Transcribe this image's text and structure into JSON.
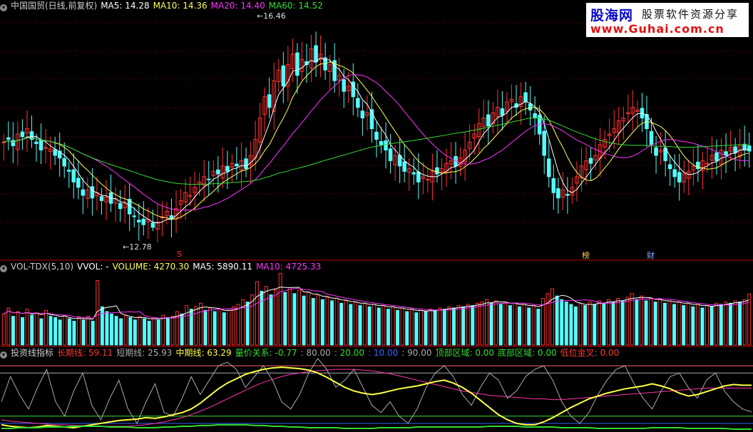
{
  "logo": {
    "name": "股海网",
    "tagline": "股票软件资源分享",
    "url": "www.Guhai.com.cn"
  },
  "price_panel": {
    "title": "中国国贸(日线,前复权)",
    "legend": [
      {
        "label": "MA5: 14.28",
        "color": "#ffffff"
      },
      {
        "label": "MA10: 14.36",
        "color": "#ffff55"
      },
      {
        "label": "MA20: 14.40",
        "color": "#ff33ff"
      },
      {
        "label": "MA60: 14.52",
        "color": "#33dd33"
      }
    ],
    "high_label": "16.46",
    "low_label": "12.78",
    "markers": [
      {
        "text": "S",
        "color": "#ff3333"
      },
      {
        "text": "榜",
        "color": "#ffcc55"
      },
      {
        "text": "财",
        "color": "#88aaff"
      }
    ]
  },
  "volume_panel": {
    "title": "VOL-TDX(5,10)",
    "legend": [
      {
        "label": "VVOL: -",
        "color": "#ffffff"
      },
      {
        "label": "VOLUME: 4270.30",
        "color": "#ffff55"
      },
      {
        "label": "MA5: 5890.11",
        "color": "#ffffff"
      },
      {
        "label": "MA10: 4725.33",
        "color": "#ff33ff"
      }
    ]
  },
  "indicator_panel": {
    "title": "投资线指标",
    "legend": [
      {
        "label": "长期线: 59.11",
        "color": "#ff3333"
      },
      {
        "label": "短期线: 25.93",
        "color": "#aaaaaa"
      },
      {
        "label": "中期线: 63.29",
        "color": "#ffff44"
      },
      {
        "label": "量价关系: -0.77",
        "color": "#33dd33"
      },
      {
        "label": ": 80.00",
        "color": "#aaaaaa"
      },
      {
        "label": ": 20.00",
        "color": "#33dd33"
      },
      {
        "label": ": 10.00",
        "color": "#3366ff"
      },
      {
        "label": ": 90.00",
        "color": "#aaaaaa"
      },
      {
        "label": "顶部区域: 0.00",
        "color": "#33dd33"
      },
      {
        "label": "底部区域: 0.00",
        "color": "#33dd33"
      },
      {
        "label": "低位金叉: 0.00",
        "color": "#ff3333"
      }
    ]
  },
  "colors": {
    "up": "#ff3232",
    "down": "#54fcfc",
    "grid": "#7a0000",
    "sep": "#c00000"
  },
  "chart_data": [
    {
      "type": "candlestick",
      "ylim": [
        12.3,
        16.9
      ],
      "high": 16.46,
      "low": 12.78,
      "ma_periods": [
        5,
        10,
        20,
        60
      ],
      "closes": [
        14.45,
        14.5,
        14.38,
        14.6,
        14.55,
        14.7,
        14.5,
        14.42,
        14.3,
        14.35,
        14.32,
        14.2,
        14.15,
        14.0,
        13.9,
        13.7,
        13.6,
        13.45,
        13.55,
        13.4,
        13.5,
        13.35,
        13.42,
        13.3,
        13.38,
        13.2,
        13.3,
        13.1,
        13.05,
        12.95,
        12.9,
        13.0,
        12.85,
        12.95,
        13.05,
        13.15,
        13.0,
        13.2,
        13.35,
        13.5,
        13.45,
        13.6,
        13.7,
        13.8,
        13.75,
        13.9,
        13.85,
        14.0,
        13.9,
        14.05,
        14.0,
        14.1,
        13.95,
        14.2,
        14.5,
        14.9,
        15.3,
        15.1,
        15.6,
        15.8,
        15.5,
        15.9,
        16.1,
        15.7,
        16.0,
        15.9,
        16.2,
        15.95,
        16.1,
        15.8,
        15.9,
        15.6,
        15.7,
        15.4,
        15.5,
        15.3,
        15.1,
        14.9,
        15.0,
        14.7,
        14.5,
        14.4,
        14.3,
        14.1,
        14.2,
        14.0,
        13.9,
        13.95,
        13.85,
        13.7,
        13.8,
        13.75,
        13.9,
        13.85,
        13.95,
        14.05,
        14.1,
        14.0,
        14.15,
        14.3,
        14.45,
        14.6,
        14.8,
        14.9,
        14.75,
        15.0,
        15.1,
        14.95,
        15.2,
        15.25,
        15.1,
        15.3,
        15.2,
        15.05,
        14.9,
        14.6,
        14.2,
        13.8,
        13.5,
        13.4,
        13.55,
        13.45,
        13.6,
        13.8,
        14.0,
        14.1,
        14.05,
        14.2,
        14.4,
        14.5,
        14.6,
        14.7,
        14.85,
        14.9,
        15.0,
        15.1,
        15.05,
        14.9,
        14.7,
        14.4,
        14.2,
        14.3,
        14.1,
        13.95,
        13.8,
        13.7,
        13.85,
        13.9,
        14.0,
        13.95,
        14.1,
        14.05,
        14.2,
        14.1,
        14.3,
        14.2,
        14.35,
        14.25,
        14.4,
        14.3,
        14.28
      ]
    },
    {
      "type": "bar",
      "series": [
        {
          "name": "VOLUME",
          "values": [
            2600,
            3100,
            2400,
            2800,
            2300,
            3000,
            2500,
            2700,
            2200,
            2900,
            2400,
            2300,
            2100,
            2500,
            2200,
            2000,
            2300,
            2100,
            2400,
            2000,
            5400,
            3200,
            2800,
            2600,
            2400,
            2200,
            2500,
            2300,
            2100,
            2400,
            2200,
            2000,
            2300,
            2100,
            2500,
            2300,
            2400,
            2800,
            2600,
            3300,
            3000,
            3200,
            3500,
            2900,
            3100,
            2800,
            3000,
            2700,
            2900,
            3200,
            3400,
            3800,
            3600,
            4200,
            5300,
            4500,
            4900,
            4200,
            4600,
            6000,
            4400,
            4800,
            4300,
            4600,
            4100,
            4400,
            3900,
            4200,
            3800,
            4000,
            3700,
            3900,
            3500,
            3700,
            3400,
            3600,
            3300,
            3500,
            3200,
            3400,
            3100,
            3300,
            3000,
            3200,
            2900,
            3100,
            2800,
            3000,
            2700,
            2900,
            2800,
            3000,
            2900,
            3100,
            3000,
            3200,
            3100,
            3300,
            3200,
            3400,
            3300,
            3500,
            3600,
            3800,
            3500,
            3700,
            3400,
            3600,
            3300,
            3500,
            3200,
            3400,
            3100,
            3300,
            3000,
            3900,
            4300,
            4700,
            4100,
            3800,
            3600,
            3400,
            3200,
            3500,
            3300,
            3600,
            3400,
            3700,
            3500,
            3800,
            3600,
            3900,
            3700,
            4000,
            4300,
            3800,
            4100,
            3700,
            3900,
            3600,
            3800,
            3500,
            3700,
            3400,
            3600,
            3300,
            3500,
            3200,
            3400,
            3100,
            3300,
            3200,
            3500,
            3400,
            3600,
            3500,
            3700,
            3600,
            3800,
            4270
          ]
        }
      ]
    },
    {
      "type": "line",
      "ylim": [
        0,
        100
      ],
      "levels": [
        10,
        20,
        80,
        90
      ],
      "series": [
        {
          "name": "长期线",
          "values": [
            15,
            13,
            12,
            11,
            10,
            9,
            8,
            8,
            7,
            7,
            6,
            6,
            6,
            6,
            6,
            7,
            8,
            10,
            12,
            15,
            18,
            22,
            27,
            32,
            38,
            44,
            50,
            56,
            62,
            67,
            71,
            75,
            78,
            80,
            82,
            83,
            84,
            85,
            85,
            85,
            84,
            83,
            81,
            79,
            76,
            73,
            70,
            67,
            64,
            61,
            58,
            55,
            53,
            51,
            49,
            48,
            47,
            46,
            45,
            44,
            44,
            43,
            43,
            44,
            45,
            46,
            47,
            48,
            49,
            50,
            51,
            52,
            53,
            54,
            55,
            56,
            57,
            58,
            59,
            59,
            59,
            59,
            59,
            59
          ]
        },
        {
          "name": "短期线",
          "values": [
            40,
            75,
            50,
            30,
            60,
            85,
            40,
            20,
            55,
            80,
            35,
            15,
            45,
            70,
            30,
            10,
            40,
            65,
            25,
            20,
            45,
            75,
            50,
            70,
            90,
            95,
            85,
            60,
            75,
            90,
            70,
            40,
            30,
            50,
            80,
            100,
            85,
            60,
            70,
            85,
            60,
            35,
            25,
            40,
            20,
            10,
            30,
            60,
            80,
            90,
            75,
            50,
            35,
            60,
            80,
            70,
            45,
            55,
            75,
            85,
            90,
            70,
            40,
            20,
            10,
            25,
            50,
            70,
            85,
            90,
            65,
            45,
            30,
            55,
            75,
            80,
            60,
            45,
            70,
            80,
            55,
            40,
            30,
            26
          ]
        },
        {
          "name": "中期线",
          "values": [
            8,
            6,
            5,
            4,
            5,
            7,
            6,
            5,
            4,
            6,
            8,
            10,
            12,
            14,
            15,
            16,
            18,
            17,
            19,
            22,
            25,
            30,
            38,
            48,
            58,
            66,
            72,
            78,
            82,
            85,
            87,
            88,
            87,
            86,
            84,
            80,
            74,
            67,
            60,
            55,
            52,
            50,
            52,
            55,
            58,
            60,
            62,
            65,
            68,
            70,
            66,
            60,
            52,
            42,
            32,
            22,
            15,
            10,
            8,
            8,
            12,
            18,
            25,
            32,
            38,
            44,
            48,
            52,
            55,
            58,
            60,
            62,
            65,
            62,
            58,
            52,
            48,
            50,
            54,
            58,
            62,
            64,
            63,
            63
          ]
        },
        {
          "name": "量价关系",
          "values": [
            3,
            3,
            4,
            4,
            4,
            5,
            5,
            5,
            6,
            6,
            6,
            6,
            5,
            5,
            5,
            4,
            4,
            4,
            5,
            5,
            6,
            6,
            7,
            7,
            8,
            8,
            8,
            8,
            7,
            7,
            6,
            6,
            5,
            5,
            4,
            4,
            4,
            4,
            3,
            3,
            3,
            3,
            4,
            4,
            4,
            4,
            5,
            5,
            5,
            5,
            5,
            5,
            5,
            5,
            6,
            6,
            6,
            6,
            5,
            5,
            5,
            5,
            4,
            4,
            4,
            4,
            3,
            3,
            3,
            3,
            3,
            3,
            4,
            4,
            4,
            4,
            3,
            3,
            3,
            3,
            3,
            2,
            2,
            2
          ]
        }
      ]
    }
  ]
}
